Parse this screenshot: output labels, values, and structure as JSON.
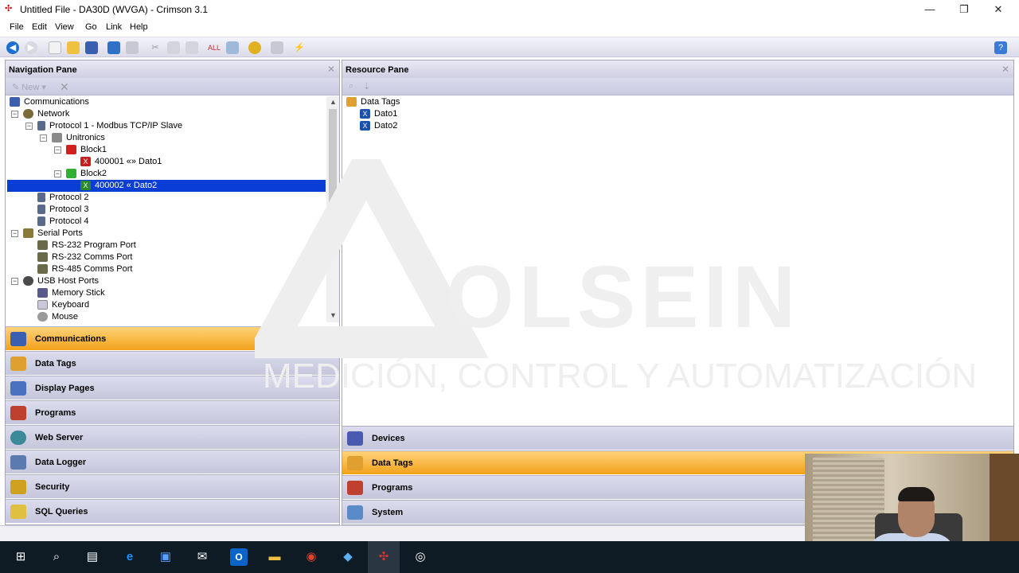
{
  "window": {
    "title": "Untitled File - DA30D (WVGA) - Crimson 3.1",
    "minimize": "—",
    "restore": "❐",
    "close": "✕"
  },
  "menu": [
    "File",
    "Edit",
    "View",
    "Go",
    "Link",
    "Help"
  ],
  "navigation_pane": {
    "title": "Navigation Pane",
    "toolbar_new": "New",
    "tree": [
      {
        "label": "Communications"
      },
      {
        "label": "Network"
      },
      {
        "label": "Protocol 1 - Modbus TCP/IP Slave"
      },
      {
        "label": "Unitronics"
      },
      {
        "label": "Block1"
      },
      {
        "label": "400001 «» Dato1"
      },
      {
        "label": "Block2"
      },
      {
        "label": "400002 « Dato2"
      },
      {
        "label": "Protocol 2"
      },
      {
        "label": "Protocol 3"
      },
      {
        "label": "Protocol 4"
      },
      {
        "label": "Serial Ports"
      },
      {
        "label": "RS-232 Program Port"
      },
      {
        "label": "RS-232 Comms Port"
      },
      {
        "label": "RS-485 Comms Port"
      },
      {
        "label": "USB Host Ports"
      },
      {
        "label": "Memory Stick"
      },
      {
        "label": "Keyboard"
      },
      {
        "label": "Mouse"
      }
    ],
    "categories": [
      "Communications",
      "Data Tags",
      "Display Pages",
      "Programs",
      "Web Server",
      "Data Logger",
      "Security",
      "SQL Queries"
    ],
    "active_category": "Communications"
  },
  "resource_pane": {
    "title": "Resource Pane",
    "tree": [
      {
        "label": "Data Tags"
      },
      {
        "label": "Dato1"
      },
      {
        "label": "Dato2"
      }
    ],
    "categories": [
      "Devices",
      "Data Tags",
      "Programs",
      "System"
    ],
    "active_category": "Data Tags"
  },
  "watermark": {
    "brand": "OLSEIN",
    "tagline": "MEDICIÓN, CONTROL Y AUTOMATIZACIÓN"
  },
  "colors": {
    "selection": "#0a3dd6",
    "active_category": "#f2a21a",
    "taskbar": "#0e1a24"
  }
}
